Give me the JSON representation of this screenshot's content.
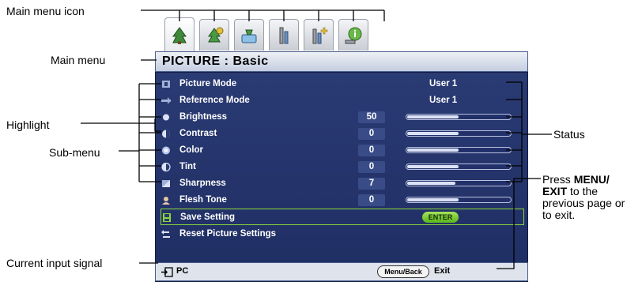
{
  "annotations": {
    "main_menu_icon": "Main menu icon",
    "main_menu": "Main menu",
    "highlight": "Highlight",
    "sub_menu": "Sub-menu",
    "current_input_signal": "Current input signal",
    "status": "Status",
    "press_prefix": "Press ",
    "press_bold": "MENU/ EXIT",
    "press_suffix": " to the previous page or to exit."
  },
  "osd": {
    "title": "PICTURE : Basic",
    "tabs": [
      {
        "icon": "picture-tab-icon"
      },
      {
        "icon": "picture-advanced-tab-icon"
      },
      {
        "icon": "display-tab-icon"
      },
      {
        "icon": "setting-basic-tab-icon"
      },
      {
        "icon": "setting-advanced-tab-icon"
      },
      {
        "icon": "information-tab-icon"
      }
    ],
    "rows": [
      {
        "label": "Picture Mode",
        "status": "User 1"
      },
      {
        "label": "Reference Mode",
        "status": "User 1"
      },
      {
        "label": "Brightness",
        "value": "50",
        "level": 0.5
      },
      {
        "label": "Contrast",
        "value": "0",
        "level": 0.5
      },
      {
        "label": "Color",
        "value": "0",
        "level": 0.5
      },
      {
        "label": "Tint",
        "value": "0",
        "level": 0.5
      },
      {
        "label": "Sharpness",
        "value": "7",
        "level": 0.47
      },
      {
        "label": "Flesh Tone",
        "value": "0",
        "level": 0.5
      },
      {
        "label": "Save Setting",
        "button": "ENTER"
      },
      {
        "label": "Reset Picture Settings"
      }
    ],
    "footer": {
      "source": "PC",
      "menu_button": "Menu/Back",
      "exit": "Exit"
    }
  }
}
